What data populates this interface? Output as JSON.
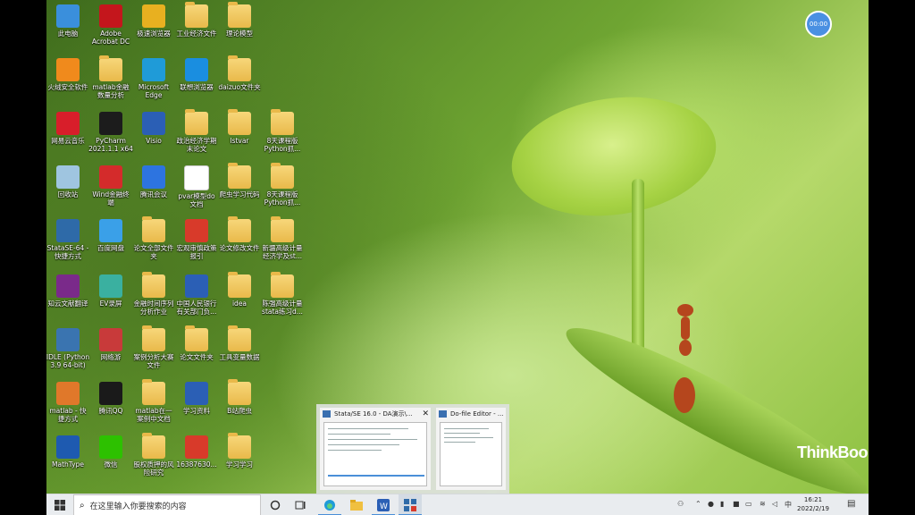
{
  "desktop": {
    "icons": [
      {
        "label": "此电脑",
        "kind": "pc",
        "color": "#3a8fdc",
        "col": 0,
        "row": 0
      },
      {
        "label": "Adobe\nAcrobat DC",
        "kind": "app",
        "color": "#c4161c",
        "col": 1,
        "row": 0
      },
      {
        "label": "极速浏览器",
        "kind": "app",
        "color": "#e8b020",
        "col": 2,
        "row": 0
      },
      {
        "label": "工业经济文件",
        "kind": "folder",
        "col": 3,
        "row": 0
      },
      {
        "label": "理论模型",
        "kind": "folder",
        "col": 4,
        "row": 0
      },
      {
        "label": "火绒安全软件",
        "kind": "app",
        "color": "#f08a1c",
        "col": 0,
        "row": 1
      },
      {
        "label": "matlab金融\n数量分析",
        "kind": "folder",
        "col": 1,
        "row": 1
      },
      {
        "label": "Microsoft\nEdge",
        "kind": "app",
        "color": "#1f9bd8",
        "col": 2,
        "row": 1
      },
      {
        "label": "联想浏览器",
        "kind": "app",
        "color": "#1a8ee0",
        "col": 3,
        "row": 1
      },
      {
        "label": "daizuo文件夹",
        "kind": "folder",
        "col": 4,
        "row": 1
      },
      {
        "label": "网易云音乐",
        "kind": "app",
        "color": "#d81e2a",
        "col": 0,
        "row": 2
      },
      {
        "label": "PyCharm\n2021.1.1 x64",
        "kind": "app",
        "color": "#1c1c1c",
        "col": 1,
        "row": 2
      },
      {
        "label": "Visio",
        "kind": "app",
        "color": "#2b5fb5",
        "col": 2,
        "row": 2
      },
      {
        "label": "政治经济学期\n末论文",
        "kind": "folder",
        "col": 3,
        "row": 2
      },
      {
        "label": "lstvar",
        "kind": "folder",
        "col": 4,
        "row": 2
      },
      {
        "label": "8天课程版\nPython抓...",
        "kind": "folder",
        "col": 5,
        "row": 2
      },
      {
        "label": "回收站",
        "kind": "bin",
        "color": "#9fc5e0",
        "col": 0,
        "row": 3
      },
      {
        "label": "Wind金融终\n端",
        "kind": "app",
        "color": "#d42b2b",
        "col": 1,
        "row": 3
      },
      {
        "label": "腾讯会议",
        "kind": "app",
        "color": "#2d74e0",
        "col": 2,
        "row": 3
      },
      {
        "label": "pvar模型do\n文档",
        "kind": "doc",
        "col": 3,
        "row": 3
      },
      {
        "label": "爬虫学习代码",
        "kind": "folder",
        "col": 4,
        "row": 3
      },
      {
        "label": "8天课程版\nPython抓...",
        "kind": "folder",
        "col": 5,
        "row": 3
      },
      {
        "label": "StataSE-64 -\n快捷方式",
        "kind": "app",
        "color": "#2e6aa8",
        "col": 0,
        "row": 4
      },
      {
        "label": "百度网盘",
        "kind": "app",
        "color": "#3aa0e8",
        "col": 1,
        "row": 4
      },
      {
        "label": "论文全部文件\n夹",
        "kind": "folder",
        "col": 2,
        "row": 4
      },
      {
        "label": "宏观审慎政策\n报引",
        "kind": "app",
        "color": "#d83a2a",
        "col": 3,
        "row": 4
      },
      {
        "label": "论文修改文件",
        "kind": "folder",
        "col": 4,
        "row": 4
      },
      {
        "label": "新疆高级计量\n经济学及st...",
        "kind": "folder",
        "col": 5,
        "row": 4
      },
      {
        "label": "知云文献翻译",
        "kind": "app",
        "color": "#7a2a8a",
        "col": 0,
        "row": 5
      },
      {
        "label": "EV录屏",
        "kind": "app",
        "color": "#3ab0a0",
        "col": 1,
        "row": 5
      },
      {
        "label": "金融时间序列\n分析作业",
        "kind": "folder",
        "col": 2,
        "row": 5
      },
      {
        "label": "中国人民银行\n有关部门负...",
        "kind": "app",
        "color": "#2b5fb5",
        "col": 3,
        "row": 5
      },
      {
        "label": "idea",
        "kind": "folder",
        "col": 4,
        "row": 5
      },
      {
        "label": "陈强高级计量\nstata练习d...",
        "kind": "folder",
        "col": 5,
        "row": 5
      },
      {
        "label": "IDLE (Python\n3.9 64-bit)",
        "kind": "app",
        "color": "#3a74b0",
        "col": 0,
        "row": 6
      },
      {
        "label": "网络游",
        "kind": "app",
        "color": "#c83a3a",
        "col": 1,
        "row": 6
      },
      {
        "label": "案例分析大赛\n文件",
        "kind": "folder",
        "col": 2,
        "row": 6
      },
      {
        "label": "论文文件夹",
        "kind": "folder",
        "col": 3,
        "row": 6
      },
      {
        "label": "工具变量数据",
        "kind": "folder",
        "col": 4,
        "row": 6
      },
      {
        "label": "matlab - 快\n捷方式",
        "kind": "app",
        "color": "#e0782a",
        "col": 0,
        "row": 7
      },
      {
        "label": "腾讯QQ",
        "kind": "app",
        "color": "#1a1a1a",
        "col": 1,
        "row": 7
      },
      {
        "label": "matlab在一\n案例中文档",
        "kind": "folder",
        "col": 2,
        "row": 7
      },
      {
        "label": "学习资料",
        "kind": "app",
        "color": "#2b5fb5",
        "col": 3,
        "row": 7
      },
      {
        "label": "B站爬虫",
        "kind": "folder",
        "col": 4,
        "row": 7
      },
      {
        "label": "MathType",
        "kind": "app",
        "color": "#1e5ab0",
        "col": 0,
        "row": 8
      },
      {
        "label": "微信",
        "kind": "app",
        "color": "#2dc100",
        "col": 1,
        "row": 8
      },
      {
        "label": "股权质押的风\n险研究",
        "kind": "folder",
        "col": 2,
        "row": 8
      },
      {
        "label": "16387630...",
        "kind": "app",
        "color": "#d83a2a",
        "col": 3,
        "row": 8
      },
      {
        "label": "学习学习",
        "kind": "folder",
        "col": 4,
        "row": 8
      }
    ],
    "timer_label": "00:00",
    "brand": "ThinkBook"
  },
  "previews": [
    {
      "title": "Stata/SE 16.0 - DA演示\\...",
      "close": "✕"
    },
    {
      "title": "Do-file Editor - ..."
    }
  ],
  "taskbar": {
    "search_placeholder": "在这里输入你要搜索的内容",
    "apps": [
      "start-icon",
      "cortana-icon",
      "taskview-icon",
      "edge-icon",
      "explorer-icon",
      "word-icon",
      "stata-icon"
    ],
    "clock_time": "16:21",
    "clock_date": "2022/2/19",
    "ime": "中"
  }
}
